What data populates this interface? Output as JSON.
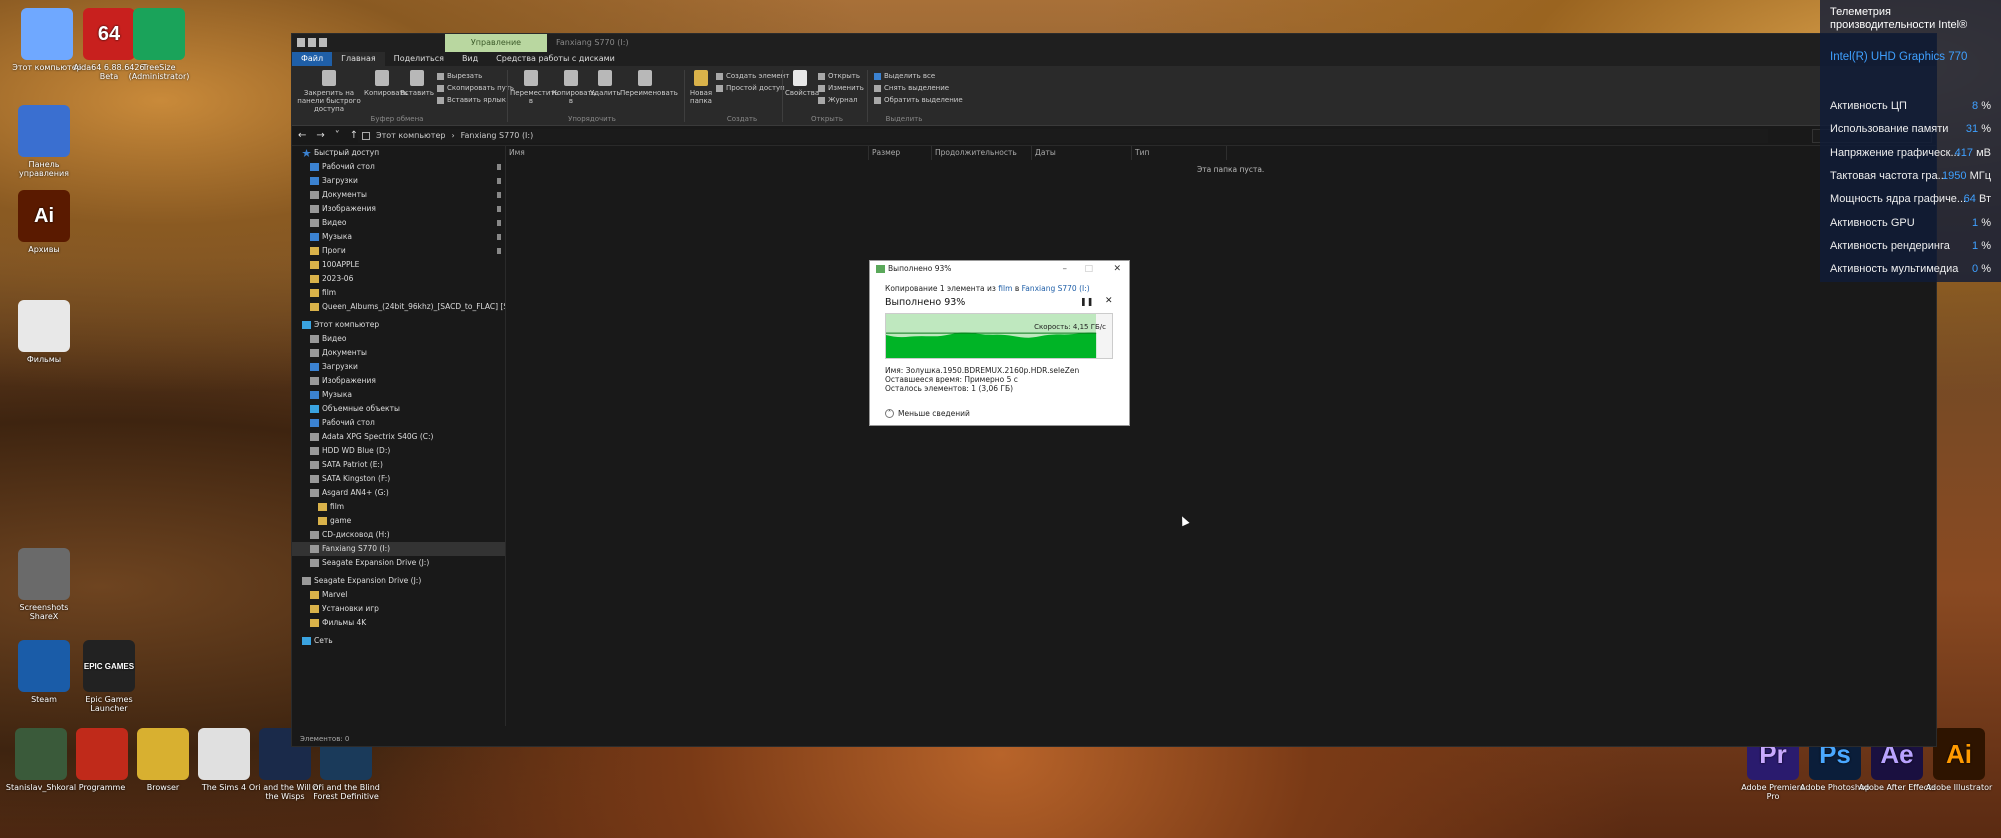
{
  "desktop": {
    "icons_left": [
      {
        "label": "Этот компьютер",
        "glyph": ""
      },
      {
        "label": "Aida64 6.88.6426 Beta",
        "glyph": "64"
      },
      {
        "label": "TreeSize (Administrator)",
        "glyph": ""
      },
      {
        "label": "Панель управления",
        "glyph": ""
      },
      {
        "label": "Архивы",
        "glyph": "Ai"
      },
      {
        "label": "Фильмы",
        "glyph": ""
      },
      {
        "label": "Screenshots ShareX",
        "glyph": ""
      },
      {
        "label": "Steam",
        "glyph": ""
      },
      {
        "label": "Epic Games Launcher",
        "glyph": "EPIC GAMES"
      }
    ],
    "icons_bottom": [
      {
        "label": "Stanislav_Shkoral",
        "glyph": ""
      },
      {
        "label": "Programme",
        "glyph": ""
      },
      {
        "label": "Browser",
        "glyph": ""
      },
      {
        "label": "The Sims 4",
        "glyph": ""
      },
      {
        "label": "Ori and the Will of the Wisps",
        "glyph": ""
      },
      {
        "label": "Ori and the Blind Forest Definitive",
        "glyph": ""
      }
    ],
    "icons_right": [
      {
        "label": "Adobe Premiere Pro",
        "glyph": "Pr",
        "color": "#2a1b6e",
        "fg": "#c9a9ff"
      },
      {
        "label": "Adobe Photoshop",
        "glyph": "Ps",
        "color": "#0b1e3a",
        "fg": "#4aa8ff"
      },
      {
        "label": "Adobe After Effects",
        "glyph": "Ae",
        "color": "#1a1040",
        "fg": "#b9a2ff"
      },
      {
        "label": "Adobe Illustrator",
        "glyph": "Ai",
        "color": "#2e1400",
        "fg": "#ff9a00"
      }
    ]
  },
  "explorer": {
    "title_context_tab": "Управление",
    "title_path": "Fanxiang S770 (I:)",
    "tabs": [
      "Файл",
      "Главная",
      "Поделиться",
      "Вид",
      "Средства работы с дисками"
    ],
    "ribbon": {
      "pin": "Закрепить на панели быстрого доступа",
      "copy": "Копировать",
      "paste": "Вставить",
      "cut": "Вырезать",
      "copy_path": "Скопировать путь",
      "paste_shortcut": "Вставить ярлык",
      "group_clipboard": "Буфер обмена",
      "move": "Переместить в",
      "copy_to": "Копировать в",
      "delete": "Удалить",
      "rename": "Переименовать",
      "group_organize": "Упорядочить",
      "new_folder": "Новая папка",
      "new_item": "Создать элемент",
      "easy_access": "Простой доступ",
      "group_create": "Создать",
      "properties": "Свойства",
      "open": "Открыть",
      "edit": "Изменить",
      "history": "Журнал",
      "group_open": "Открыть",
      "select_all": "Выделить все",
      "select_none": "Снять выделение",
      "invert_select": "Обратить выделение",
      "group_select": "Выделить"
    },
    "address": [
      "Этот компьютер",
      "Fanxiang S770 (I:)"
    ],
    "nav": [
      {
        "label": "Быстрый доступ",
        "icon": "star",
        "indent": 8,
        "pin": false
      },
      {
        "label": "Рабочий стол",
        "icon": "bl",
        "indent": 16,
        "pin": true
      },
      {
        "label": "Загрузки",
        "icon": "bl",
        "indent": 16,
        "pin": true
      },
      {
        "label": "Документы",
        "icon": "dr",
        "indent": 16,
        "pin": true
      },
      {
        "label": "Изображения",
        "icon": "dr",
        "indent": 16,
        "pin": true
      },
      {
        "label": "Видео",
        "icon": "dr",
        "indent": 16,
        "pin": true
      },
      {
        "label": "Музыка",
        "icon": "bl",
        "indent": 16,
        "pin": true
      },
      {
        "label": "Проги",
        "icon": "f",
        "indent": 16,
        "pin": true
      },
      {
        "label": "100APPLE",
        "icon": "f",
        "indent": 16,
        "pin": false
      },
      {
        "label": "2023-06",
        "icon": "f",
        "indent": 16,
        "pin": false
      },
      {
        "label": "film",
        "icon": "f",
        "indent": 16,
        "pin": false
      },
      {
        "label": "Queen_Albums_(24bit_96khz)_[SACD_to_FLAC] [SARACON]",
        "icon": "f",
        "indent": 16,
        "pin": false
      },
      {
        "label": "Этот компьютер",
        "icon": "gr",
        "indent": 8,
        "pin": false
      },
      {
        "label": "Видео",
        "icon": "dr",
        "indent": 16,
        "pin": false
      },
      {
        "label": "Документы",
        "icon": "dr",
        "indent": 16,
        "pin": false
      },
      {
        "label": "Загрузки",
        "icon": "bl",
        "indent": 16,
        "pin": false
      },
      {
        "label": "Изображения",
        "icon": "dr",
        "indent": 16,
        "pin": false
      },
      {
        "label": "Музыка",
        "icon": "bl",
        "indent": 16,
        "pin": false
      },
      {
        "label": "Объемные объекты",
        "icon": "gr",
        "indent": 16,
        "pin": false
      },
      {
        "label": "Рабочий стол",
        "icon": "bl",
        "indent": 16,
        "pin": false
      },
      {
        "label": "Adata XPG Spectrix S40G (C:)",
        "icon": "dr",
        "indent": 16,
        "pin": false
      },
      {
        "label": "HDD WD Blue (D:)",
        "icon": "dr",
        "indent": 16,
        "pin": false
      },
      {
        "label": "SATA Patriot (E:)",
        "icon": "dr",
        "indent": 16,
        "pin": false
      },
      {
        "label": "SATA Kingston (F:)",
        "icon": "dr",
        "indent": 16,
        "pin": false
      },
      {
        "label": "Asgard AN4+ (G:)",
        "icon": "dr",
        "indent": 16,
        "pin": false
      },
      {
        "label": "film",
        "icon": "f",
        "indent": 24,
        "pin": false
      },
      {
        "label": "game",
        "icon": "f",
        "indent": 24,
        "pin": false
      },
      {
        "label": "CD-дисковод (H:)",
        "icon": "dr",
        "indent": 16,
        "pin": false
      },
      {
        "label": "Fanxiang S770 (I:)",
        "icon": "dr",
        "indent": 16,
        "pin": false,
        "selected": true
      },
      {
        "label": "Seagate Expansion Drive (J:)",
        "icon": "dr",
        "indent": 16,
        "pin": false
      },
      {
        "label": "Seagate Expansion Drive (J:)",
        "icon": "dr",
        "indent": 8,
        "pin": false
      },
      {
        "label": "Marvel",
        "icon": "f",
        "indent": 16,
        "pin": false
      },
      {
        "label": "Установки игр",
        "icon": "f",
        "indent": 16,
        "pin": false
      },
      {
        "label": "Фильмы 4K",
        "icon": "f",
        "indent": 16,
        "pin": false
      },
      {
        "label": "Сеть",
        "icon": "gr",
        "indent": 8,
        "pin": false
      }
    ],
    "columns": [
      "Имя",
      "Размер",
      "Продолжительность",
      "Даты",
      "Тип"
    ],
    "empty_text": "Эта папка пуста.",
    "status": "Элементов: 0"
  },
  "copy_dialog": {
    "title": "Выполнено 93%",
    "desc_prefix": "Копирование 1 элемента из",
    "from": "film",
    "to_word": "в",
    "to": "Fanxiang S770 (I:)",
    "heading": "Выполнено 93%",
    "progress": 0.93,
    "speed": "Скорость: 4,15 ГБ/с",
    "name_label": "Имя:",
    "name_value": "Золушка.1950.BDREMUX.2160p.HDR.seleZen",
    "time_label": "Оставшееся время:",
    "time_value": "Примерно 5 с",
    "items_label": "Осталось элементов:",
    "items_value": "1 (3,06 ГБ)",
    "less_details": "Меньше сведений"
  },
  "telemetry": {
    "title": "Телеметрия производительности Intel®",
    "gpu": "Intel(R) UHD Graphics 770",
    "rows": [
      {
        "label": "Активность ЦП",
        "value": "8",
        "unit": "%"
      },
      {
        "label": "Использование памяти",
        "value": "31",
        "unit": "%"
      },
      {
        "label": "Напряжение графическ...",
        "value": "417",
        "unit": "мВ"
      },
      {
        "label": "Тактовая частота гра...",
        "value": "1950",
        "unit": "МГц"
      },
      {
        "label": "Мощность ядра графиче...",
        "value": "64",
        "unit": "Вт"
      },
      {
        "label": "Активность GPU",
        "value": "1",
        "unit": "%"
      },
      {
        "label": "Активность рендеринга",
        "value": "1",
        "unit": "%"
      },
      {
        "label": "Активность мультимедиа",
        "value": "0",
        "unit": "%"
      }
    ]
  },
  "colors": {
    "accent": "#1f5fa8",
    "progress": "#00b426",
    "telemetry_value": "#3fa0ff",
    "context_tab": "#b9d7a0"
  }
}
